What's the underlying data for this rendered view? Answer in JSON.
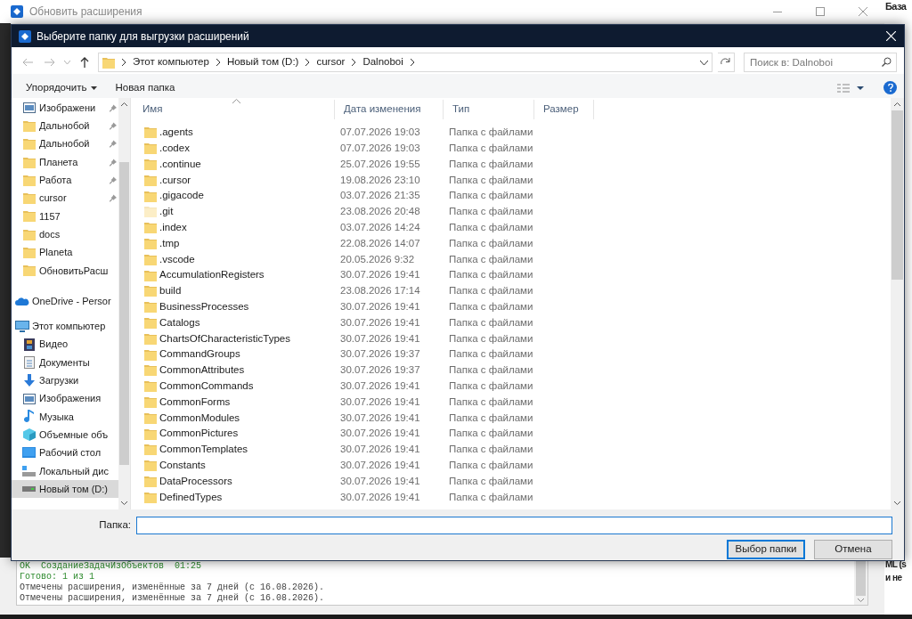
{
  "back_window": {
    "title": "Обновить расширения",
    "log": [
      {
        "color": "#2e8b2e",
        "text": "OK  СозданиеЗадачИзОбъектов  01:25"
      },
      {
        "color": "#2e8b2e",
        "text": "Готово: 1 из 1"
      },
      {
        "color": "#444444",
        "text": "Отмечены расширения, изменённые за 7 дней (с 16.08.2026)."
      },
      {
        "color": "#444444",
        "text": "Отмечены расширения, изменённые за 7 дней (с 16.08.2026)."
      }
    ]
  },
  "right_app": {
    "texts": [
      {
        "kind": "top",
        "text": "База"
      },
      {
        "kind": "line",
        "text": "ML (s"
      },
      {
        "kind": "line",
        "text": "и не"
      }
    ]
  },
  "dialog": {
    "title": "Выберите папку для выгрузки расширений",
    "breadcrumb": [
      "Этот компьютер",
      "Новый том (D:)",
      "cursor",
      "Dalnoboi"
    ],
    "search": {
      "placeholder": "Поиск в: Dalnoboi"
    },
    "toolbar": {
      "organize": "Упорядочить",
      "new_folder": "Новая папка"
    },
    "sidebar": {
      "items": [
        {
          "kind": "pictures",
          "label": "Изображени",
          "pinned": true,
          "selected": false
        },
        {
          "kind": "folder",
          "label": "Дальнобой",
          "pinned": true,
          "selected": false
        },
        {
          "kind": "folder",
          "label": "Дальнобой",
          "pinned": true,
          "selected": false
        },
        {
          "kind": "folder",
          "label": "Планета",
          "pinned": true,
          "selected": false
        },
        {
          "kind": "folder",
          "label": "Работа",
          "pinned": true,
          "selected": false
        },
        {
          "kind": "folder",
          "label": "cursor",
          "pinned": true,
          "selected": false
        },
        {
          "kind": "folder",
          "label": "1157",
          "pinned": false,
          "selected": false
        },
        {
          "kind": "folder",
          "label": "docs",
          "pinned": false,
          "selected": false
        },
        {
          "kind": "folder",
          "label": "Planeta",
          "pinned": false,
          "selected": false
        },
        {
          "kind": "folder",
          "label": "ОбновитьРасш",
          "pinned": false,
          "selected": false
        },
        {
          "kind": "onedrive",
          "label": "OneDrive - Persor",
          "pinned": false,
          "selected": false
        },
        {
          "kind": "pc",
          "label": "Этот компьютер",
          "pinned": false,
          "selected": false,
          "children": [
            {
              "kind": "video",
              "label": "Видео",
              "pinned": false,
              "selected": false
            },
            {
              "kind": "docs",
              "label": "Документы",
              "pinned": false,
              "selected": false
            },
            {
              "kind": "downloads",
              "label": "Загрузки",
              "pinned": false,
              "selected": false
            },
            {
              "kind": "pictures",
              "label": "Изображения",
              "pinned": false,
              "selected": false
            },
            {
              "kind": "music",
              "label": "Музыка",
              "pinned": false,
              "selected": false
            },
            {
              "kind": "cube",
              "label": "Объемные объ",
              "pinned": false,
              "selected": false
            },
            {
              "kind": "desktop",
              "label": "Рабочий стол",
              "pinned": false,
              "selected": false
            },
            {
              "kind": "localdisk",
              "label": "Локальный дис",
              "pinned": false,
              "selected": false
            },
            {
              "kind": "drive",
              "label": "Новый том (D:)",
              "pinned": false,
              "selected": true
            }
          ]
        }
      ]
    },
    "table": {
      "columns": [
        "Имя",
        "Дата изменения",
        "Тип",
        "Размер"
      ],
      "rows": [
        {
          "name": ".agents",
          "date": "07.07.2026 19:03",
          "type": "Папка с файлами",
          "hidden": false
        },
        {
          "name": ".codex",
          "date": "07.07.2026 19:03",
          "type": "Папка с файлами",
          "hidden": false
        },
        {
          "name": ".continue",
          "date": "25.07.2026 19:55",
          "type": "Папка с файлами",
          "hidden": false
        },
        {
          "name": ".cursor",
          "date": "19.08.2026 23:10",
          "type": "Папка с файлами",
          "hidden": false
        },
        {
          "name": ".gigacode",
          "date": "03.07.2026 21:35",
          "type": "Папка с файлами",
          "hidden": false
        },
        {
          "name": ".git",
          "date": "23.08.2026 20:48",
          "type": "Папка с файлами",
          "hidden": true
        },
        {
          "name": ".index",
          "date": "03.07.2026 14:24",
          "type": "Папка с файлами",
          "hidden": false
        },
        {
          "name": ".tmp",
          "date": "22.08.2026 14:07",
          "type": "Папка с файлами",
          "hidden": false
        },
        {
          "name": ".vscode",
          "date": "20.05.2026 9:32",
          "type": "Папка с файлами",
          "hidden": false
        },
        {
          "name": "AccumulationRegisters",
          "date": "30.07.2026 19:41",
          "type": "Папка с файлами",
          "hidden": false
        },
        {
          "name": "build",
          "date": "23.08.2026 17:14",
          "type": "Папка с файлами",
          "hidden": false
        },
        {
          "name": "BusinessProcesses",
          "date": "30.07.2026 19:41",
          "type": "Папка с файлами",
          "hidden": false
        },
        {
          "name": "Catalogs",
          "date": "30.07.2026 19:41",
          "type": "Папка с файлами",
          "hidden": false
        },
        {
          "name": "ChartsOfCharacteristicTypes",
          "date": "30.07.2026 19:41",
          "type": "Папка с файлами",
          "hidden": false
        },
        {
          "name": "CommandGroups",
          "date": "30.07.2026 19:37",
          "type": "Папка с файлами",
          "hidden": false
        },
        {
          "name": "CommonAttributes",
          "date": "30.07.2026 19:37",
          "type": "Папка с файлами",
          "hidden": false
        },
        {
          "name": "CommonCommands",
          "date": "30.07.2026 19:41",
          "type": "Папка с файлами",
          "hidden": false
        },
        {
          "name": "CommonForms",
          "date": "30.07.2026 19:41",
          "type": "Папка с файлами",
          "hidden": false
        },
        {
          "name": "CommonModules",
          "date": "30.07.2026 19:41",
          "type": "Папка с файлами",
          "hidden": false
        },
        {
          "name": "CommonPictures",
          "date": "30.07.2026 19:41",
          "type": "Папка с файлами",
          "hidden": false
        },
        {
          "name": "CommonTemplates",
          "date": "30.07.2026 19:41",
          "type": "Папка с файлами",
          "hidden": false
        },
        {
          "name": "Constants",
          "date": "30.07.2026 19:41",
          "type": "Папка с файлами",
          "hidden": false
        },
        {
          "name": "DataProcessors",
          "date": "30.07.2026 19:41",
          "type": "Папка с файлами",
          "hidden": false
        },
        {
          "name": "DefinedTypes",
          "date": "30.07.2026 19:41",
          "type": "Папка с файлами",
          "hidden": false
        }
      ]
    },
    "folder_field": {
      "label": "Папка:"
    },
    "buttons": [
      {
        "kind": "primary",
        "label": "Выбор папки"
      },
      {
        "kind": "secondary",
        "label": "Отмена"
      }
    ]
  }
}
